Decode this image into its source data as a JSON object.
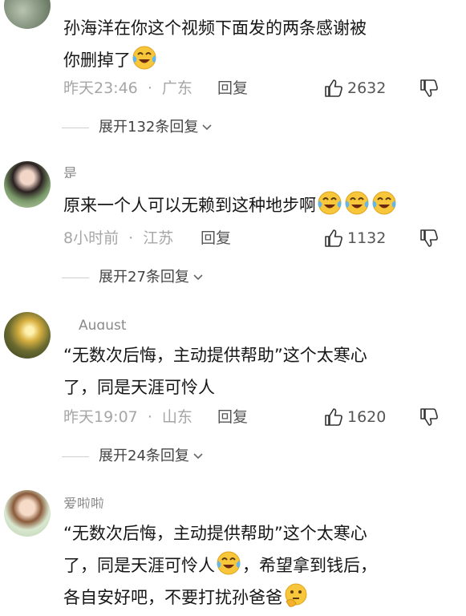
{
  "comments": [
    {
      "username": "",
      "text_lines": [
        "孙海洋在你这个视频下面发的两条感谢被",
        "你删掉了"
      ],
      "time": "昨天23:46",
      "location": "广东",
      "reply_label": "回复",
      "likes": "2632",
      "expand_label": "展开132条回复"
    },
    {
      "username": "是",
      "text_lines": [
        "原来一个人可以无赖到这种地步啊"
      ],
      "time": "8小时前",
      "location": "江苏",
      "reply_label": "回复",
      "likes": "1132",
      "expand_label": "展开27条回复"
    },
    {
      "username": "August",
      "text_lines": [
        "“无数次后悔，主动提供帮助”这个太寒心",
        "了，同是天涯可怜人"
      ],
      "time": "昨天19:07",
      "location": "山东",
      "reply_label": "回复",
      "likes": "1620",
      "expand_label": "展开24条回复"
    },
    {
      "username": "爱啦啦",
      "text_lines": [
        "“无数次后悔，主动提供帮助”这个太寒心",
        "了，同是天涯可怜人",
        "，希望拿到钱后，",
        "各自安好吧，不要打扰孙爸爸"
      ]
    }
  ],
  "meta_separator": "·",
  "icons": {
    "like": "thumbs-up-icon",
    "dislike": "thumbs-down-icon",
    "expand": "chevron-down-icon",
    "cry_laugh": "tears-of-joy-emoji",
    "thinking": "thinking-emoji"
  }
}
